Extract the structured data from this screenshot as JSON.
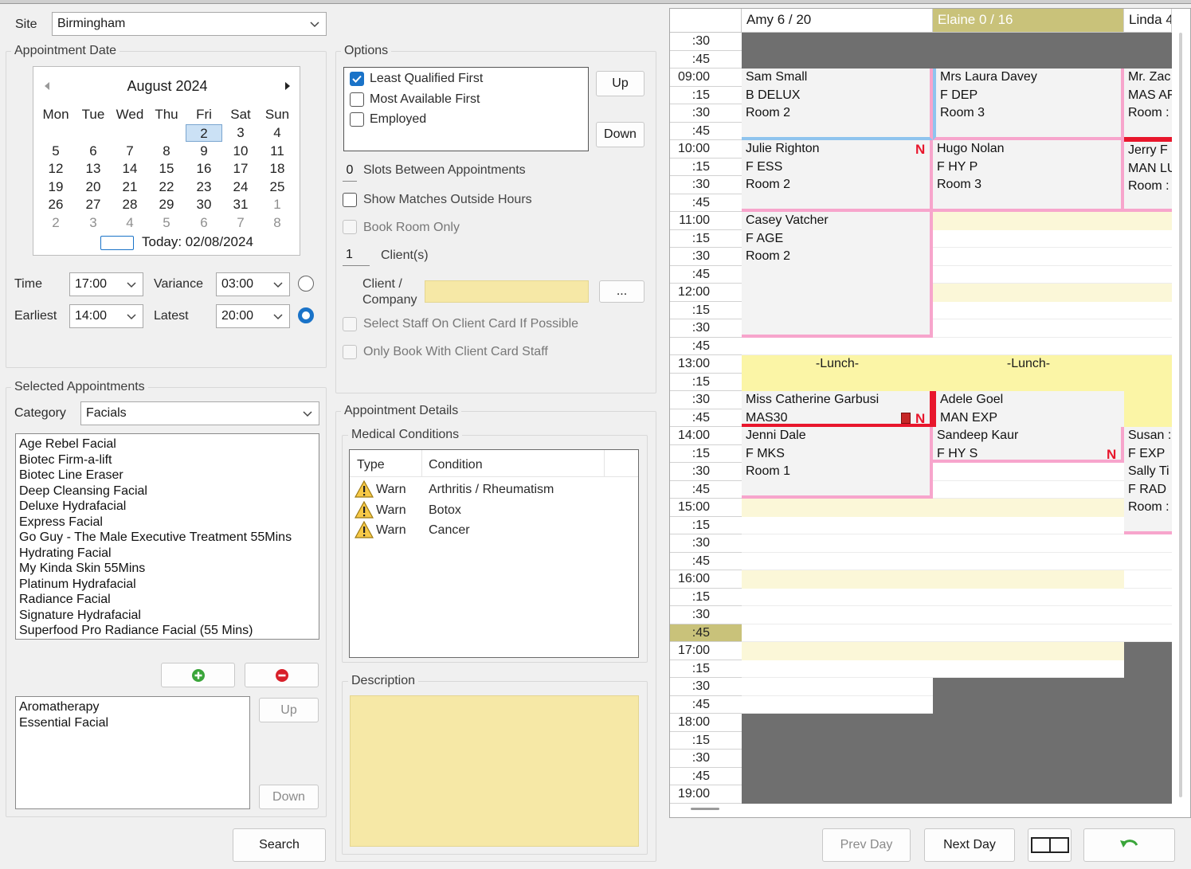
{
  "left": {
    "site_label": "Site",
    "site_value": "Birmingham",
    "appointment_date_label": "Appointment Date",
    "calendar": {
      "month": "August 2024",
      "weekdays": [
        "Mon",
        "Tue",
        "Wed",
        "Thu",
        "Fri",
        "Sat",
        "Sun"
      ],
      "weeks": [
        [
          "",
          "",
          "",
          "",
          "2",
          "3",
          "4"
        ],
        [
          "5",
          "6",
          "7",
          "8",
          "9",
          "10",
          "11"
        ],
        [
          "12",
          "13",
          "14",
          "15",
          "16",
          "17",
          "18"
        ],
        [
          "19",
          "20",
          "21",
          "22",
          "23",
          "24",
          "25"
        ],
        [
          "26",
          "27",
          "28",
          "29",
          "30",
          "31",
          "1"
        ],
        [
          "2",
          "3",
          "4",
          "5",
          "6",
          "7",
          "8"
        ]
      ],
      "selected_day": "2",
      "today": "Today: 02/08/2024"
    },
    "time_label": "Time",
    "time_value": "17:00",
    "variance_label": "Variance",
    "variance_value": "03:00",
    "earliest_label": "Earliest",
    "earliest_value": "14:00",
    "latest_label": "Latest",
    "latest_value": "20:00",
    "selected_appointments_label": "Selected Appointments",
    "category_label": "Category",
    "category_value": "Facials",
    "treatments": [
      "Age Rebel Facial",
      "Biotec Firm-a-lift",
      "Biotec Line Eraser",
      "Deep Cleansing Facial",
      "Deluxe Hydrafacial",
      "Express Facial",
      "Go Guy - The Male Executive Treatment 55Mins",
      "Hydrating Facial",
      "My Kinda Skin 55Mins",
      "Platinum Hydrafacial",
      "Radiance Facial",
      "Signature Hydrafacial",
      "Superfood Pro Radiance Facial (55 Mins)"
    ],
    "selected_list": [
      "Aromatherapy",
      "Essential Facial"
    ],
    "up_label": "Up",
    "down_label": "Down",
    "search_label": "Search"
  },
  "options": {
    "title": "Options",
    "priority": [
      {
        "label": "Least Qualified First",
        "checked": true
      },
      {
        "label": "Most Available First",
        "checked": false
      },
      {
        "label": "Employed",
        "checked": false
      }
    ],
    "up_label": "Up",
    "down_label": "Down",
    "slots_value": "0",
    "slots_label": "Slots Between Appointments",
    "show_matches_label": "Show Matches Outside Hours",
    "book_room_label": "Book Room Only",
    "clients_value": "1",
    "clients_label": "Client(s)",
    "client_company_label_1": "Client /",
    "client_company_label_2": "Company",
    "ellipsis_label": "...",
    "select_staff_label": "Select Staff On Client Card If Possible",
    "only_book_label": "Only Book With Client Card Staff"
  },
  "details": {
    "title": "Appointment Details",
    "medical_title": "Medical Conditions",
    "col_type": "Type",
    "col_condition": "Condition",
    "rows": [
      {
        "type": "Warn",
        "condition": "Arthritis / Rheumatism"
      },
      {
        "type": "Warn",
        "condition": "Botox"
      },
      {
        "type": "Warn",
        "condition": "Cancer"
      }
    ],
    "description_title": "Description"
  },
  "schedule": {
    "columns": [
      "Amy 6 / 20",
      "Elaine 0 / 16",
      "Linda 4"
    ],
    "times": [
      ":30",
      ":45",
      "09:00",
      ":15",
      ":30",
      ":45",
      "10:00",
      ":15",
      ":30",
      ":45",
      "11:00",
      ":15",
      ":30",
      ":45",
      "12:00",
      ":15",
      ":30",
      ":45",
      "13:00",
      ":15",
      ":30",
      ":45",
      "14:00",
      ":15",
      ":30",
      ":45",
      "15:00",
      ":15",
      ":30",
      ":45",
      "16:00",
      ":15",
      ":30",
      ":45",
      "17:00",
      ":15",
      ":30",
      ":45",
      "18:00",
      ":15",
      ":30",
      ":45",
      "19:00"
    ],
    "highlight_time_index": 33,
    "amy": [
      {
        "lines": [
          "Sam Small",
          "B DELUX",
          "Room 2"
        ]
      },
      {
        "lines": [
          "Julie Righton",
          "F ESS",
          "Room 2"
        ],
        "flag": "N"
      },
      {
        "lines": [
          "Casey Vatcher",
          "F AGE",
          "Room 2"
        ]
      },
      {
        "lines": [
          "Miss Catherine Garbusi",
          "MAS30"
        ],
        "flag": "N"
      },
      {
        "lines": [
          "Jenni Dale",
          "F MKS",
          "Room 1"
        ]
      }
    ],
    "elaine": [
      {
        "lines": [
          "Mrs Laura Davey",
          "F DEP",
          "Room 3"
        ]
      },
      {
        "lines": [
          "Hugo Nolan",
          "F HY P",
          "Room 3"
        ]
      },
      {
        "lines": [
          "Adele Goel",
          "MAN EXP"
        ]
      },
      {
        "lines": [
          "Sandeep Kaur",
          "F HY S"
        ],
        "flag": "N"
      }
    ],
    "linda": [
      {
        "lines": [
          "Mr. Zac",
          "MAS AF",
          "Room :"
        ]
      },
      {
        "lines": [
          "Jerry F",
          "MAN LU",
          "Room :"
        ]
      },
      {
        "lines": [
          "Susan :",
          "F EXP"
        ]
      },
      {
        "lines": [
          "Sally Ti",
          "F RAD",
          "Room :"
        ]
      }
    ],
    "lunch_label": "-Lunch-"
  },
  "bottom": {
    "prev_day": "Prev Day",
    "next_day": "Next Day"
  },
  "colors": {
    "accent_blue": "#1a73c8",
    "appt_pink": "#f7a5cc",
    "appt_blue": "#8ec4ee",
    "appt_red": "#e8162c",
    "lunch_yellow": "#fbf5a6",
    "busy_grey": "#6f6f6f",
    "elaine_header": "#c9c27a"
  }
}
